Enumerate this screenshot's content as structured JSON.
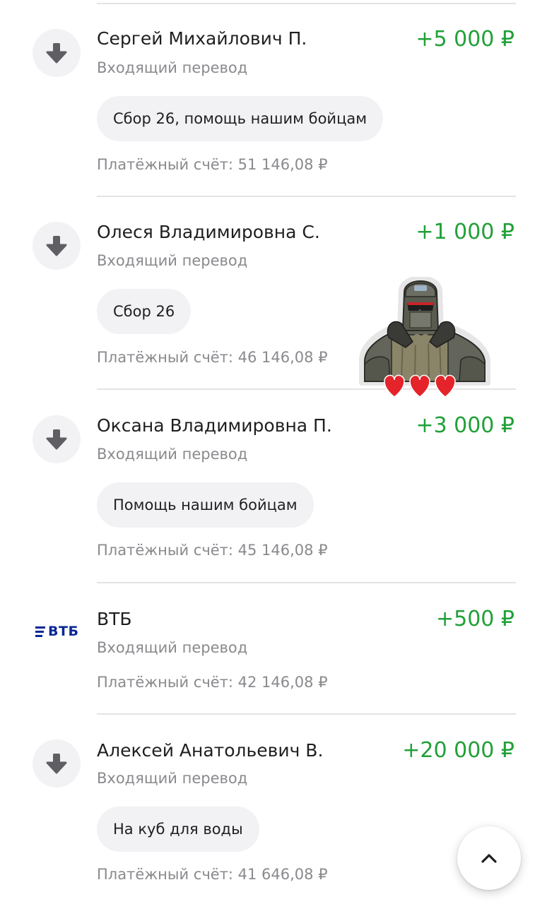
{
  "accent_color": "#21a038",
  "transactions": [
    {
      "name": "Сергей Михайлович П.",
      "amount": "+5 000 ₽",
      "type": "Входящий перевод",
      "message": "Сбор 26, помощь нашим бойцам",
      "balance": "Платёжный счёт: 51 146,08 ₽",
      "icon": "incoming-arrow-icon"
    },
    {
      "name": "Олеся Владимировна С.",
      "amount": "+1 000 ₽",
      "type": "Входящий перевод",
      "message": "Сбор 26",
      "balance": "Платёжный счёт: 46 146,08 ₽",
      "icon": "incoming-arrow-icon"
    },
    {
      "name": "Оксана Владимировна П.",
      "amount": "+3 000 ₽",
      "type": "Входящий перевод",
      "message": "Помощь нашим бойцам",
      "balance": "Платёжный счёт: 45 146,08 ₽",
      "icon": "incoming-arrow-icon"
    },
    {
      "name": "ВТБ",
      "amount": "+500 ₽",
      "type": "Входящий перевод",
      "balance": "Платёжный счёт: 42 146,08 ₽",
      "icon": "vtb-logo",
      "logo_text": "ВТБ"
    },
    {
      "name": "Алексей Анатольевич В.",
      "amount": "+20 000 ₽",
      "type": "Входящий перевод",
      "message": "На куб для воды",
      "balance": "Платёжный счёт: 41 646,08 ₽",
      "icon": "incoming-arrow-icon"
    }
  ],
  "sticker": {
    "icon": "soldier-heart-sticker"
  },
  "scroll_top": {
    "icon": "chevron-up-icon"
  }
}
